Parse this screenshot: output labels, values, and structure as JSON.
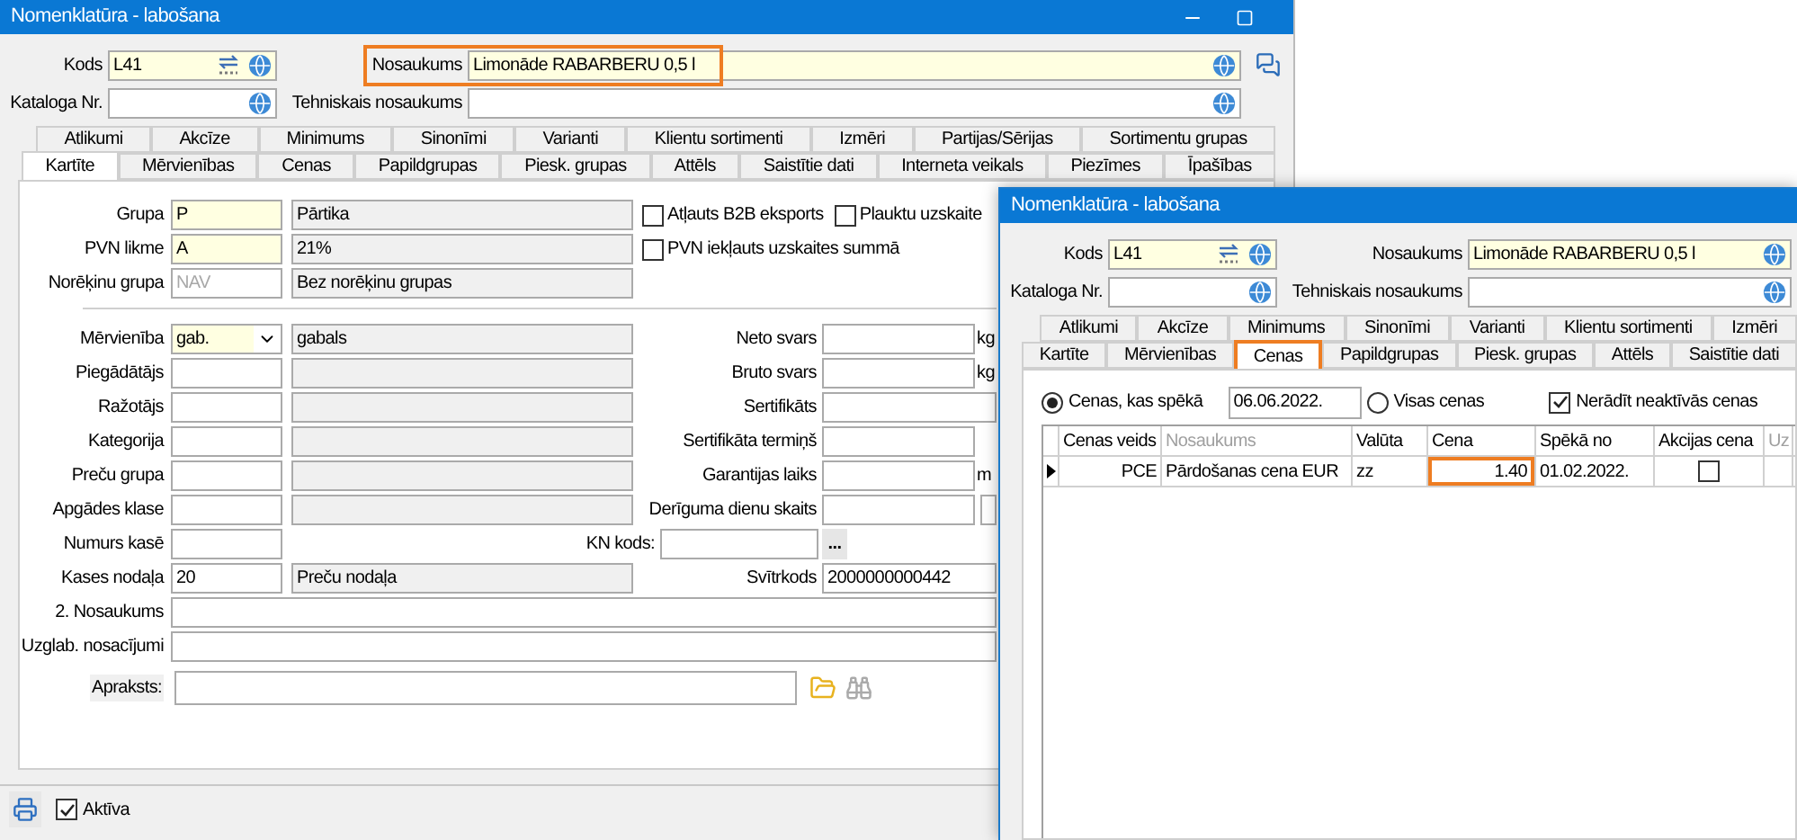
{
  "main_window": {
    "title": "Nomenklatūra - labošana",
    "header_rows": [
      {
        "code": {
          "label": "Kods",
          "value": "L41",
          "kind": "required",
          "numbering": true
        },
        "name": {
          "label": "Nosaukums",
          "value": "Limonāde RABARBERU 0,5 l",
          "kind": "required",
          "highlighted": true
        }
      },
      {
        "code": {
          "label": "Kataloga Nr.",
          "kind": "plain",
          "numbering": false
        },
        "name": {
          "label": "Tehniskais nosaukums",
          "kind": "plain",
          "highlighted": false
        }
      }
    ],
    "tab_rows": [
      [
        {
          "label": "Atlikumi",
          "selected": false
        },
        {
          "label": "Akcīze",
          "selected": false
        },
        {
          "label": "Minimums",
          "selected": false
        },
        {
          "label": "Sinonīmi",
          "selected": false
        },
        {
          "label": "Varianti",
          "selected": false
        },
        {
          "label": "Klientu sortimenti",
          "selected": false
        },
        {
          "label": "Izmēri",
          "selected": false
        },
        {
          "label": "Partijas/Sērijas",
          "selected": false
        },
        {
          "label": "Sortimentu grupas",
          "selected": false
        }
      ],
      [
        {
          "label": "Kartīte",
          "selected": true
        },
        {
          "label": "Mērvienības",
          "selected": false
        },
        {
          "label": "Cenas",
          "selected": false
        },
        {
          "label": "Papildgrupas",
          "selected": false
        },
        {
          "label": "Piesk. grupas",
          "selected": false
        },
        {
          "label": "Attēls",
          "selected": false
        },
        {
          "label": "Saistītie dati",
          "selected": false
        },
        {
          "label": "Interneta veikals",
          "selected": false
        },
        {
          "label": "Piezīmes",
          "selected": false
        },
        {
          "label": "Īpašības",
          "selected": false
        }
      ]
    ],
    "top_rows": [
      {
        "label": "Grupa",
        "code": {
          "value": "P",
          "kind": "required"
        },
        "name": "Pārtika",
        "checkboxes": [
          {
            "label": "Atļauts B2B eksports",
            "checked": false
          },
          {
            "label": "Plauktu uzskaite",
            "checked": false
          }
        ]
      },
      {
        "label": "PVN likme",
        "code": {
          "value": "A",
          "kind": "required"
        },
        "name": "21%",
        "checkboxes": [
          {
            "label": "PVN iekļauts uzskaites summā",
            "checked": false
          }
        ]
      },
      {
        "label": "Norēķinu grupa",
        "code": {
          "value": "NAV",
          "kind": "disabled"
        },
        "name": "Bez norēķinu grupas"
      }
    ],
    "detail_rows": [
      {
        "label": "Mērvienība",
        "kind": "lookup",
        "code": {
          "value": "gab.",
          "kind": "dropdown"
        },
        "name": "gabals",
        "right": {
          "label": "Neto svars",
          "kind": "unit",
          "unit": "kg"
        }
      },
      {
        "label": "Piegādātājs",
        "kind": "lookup",
        "code": {
          "kind": "plain"
        },
        "right": {
          "label": "Bruto svars",
          "kind": "unit",
          "unit": "kg"
        }
      },
      {
        "label": "Ražotājs",
        "kind": "lookup",
        "code": {
          "kind": "plain"
        },
        "right": {
          "label": "Sertifikāts",
          "kind": "wide"
        }
      },
      {
        "label": "Kategorija",
        "kind": "lookup",
        "code": {
          "kind": "plain"
        },
        "right": {
          "label": "Sertifikāta termiņš",
          "kind": "field"
        }
      },
      {
        "label": "Preču grupa",
        "kind": "lookup",
        "code": {
          "kind": "plain"
        },
        "right": {
          "label": "Garantijas laiks",
          "kind": "unit",
          "unit": "m"
        }
      },
      {
        "label": "Apgādes klase",
        "kind": "lookup",
        "code": {
          "kind": "plain"
        },
        "right": {
          "label": "Derīguma dienu skaits",
          "kind": "pair"
        }
      },
      {
        "label": "Numurs kasē",
        "kind": "single",
        "code": {
          "kind": "plain"
        },
        "right": {
          "label": "KN kods:",
          "kind": "picker",
          "button": "..."
        }
      },
      {
        "label": "Kases nodaļa",
        "kind": "lookup",
        "code": {
          "value": "20",
          "kind": "plain"
        },
        "name": "Preču nodaļa",
        "right": {
          "label": "Svītrkods",
          "kind": "wide",
          "value": "2000000000442"
        }
      }
    ],
    "full_rows": [
      {
        "label": "2. Nosaukums"
      },
      {
        "label": "Uzglab. nosacījumi"
      }
    ],
    "description": {
      "label": "Apraksts:"
    },
    "footer": {
      "active": {
        "label": "Aktīva",
        "checked": true
      }
    }
  },
  "price_window": {
    "title": "Nomenklatūra - labošana",
    "header_rows": [
      {
        "code": {
          "label": "Kods",
          "value": "L41",
          "kind": "required",
          "numbering": true
        },
        "name": {
          "label": "Nosaukums",
          "value": "Limonāde RABARBERU 0,5 l",
          "kind": "required",
          "highlighted": false
        }
      },
      {
        "code": {
          "label": "Kataloga Nr.",
          "kind": "plain",
          "numbering": false
        },
        "name": {
          "label": "Tehniskais nosaukums",
          "kind": "plain",
          "highlighted": false
        }
      }
    ],
    "tab_rows": [
      [
        {
          "label": "Atlikumi",
          "selected": false
        },
        {
          "label": "Akcīze",
          "selected": false
        },
        {
          "label": "Minimums",
          "selected": false
        },
        {
          "label": "Sinonīmi",
          "selected": false
        },
        {
          "label": "Varianti",
          "selected": false
        },
        {
          "label": "Klientu sortimenti",
          "selected": false
        },
        {
          "label": "Izmēri",
          "selected": false
        }
      ],
      [
        {
          "label": "Kartīte",
          "selected": false
        },
        {
          "label": "Mērvienības",
          "selected": false
        },
        {
          "label": "Cenas",
          "selected": true,
          "highlighted": true
        },
        {
          "label": "Papildgrupas",
          "selected": false
        },
        {
          "label": "Piesk. grupas",
          "selected": false
        },
        {
          "label": "Attēls",
          "selected": false
        },
        {
          "label": "Saistītie dati",
          "selected": false
        }
      ]
    ],
    "filters": {
      "radios": [
        {
          "label": "Cenas, kas spēkā",
          "selected": true
        },
        {
          "label": "Visas cenas",
          "selected": false
        }
      ],
      "date": "06.06.2022.",
      "checkbox": {
        "label": "Nerādīt neaktīvās cenas",
        "checked": true
      }
    },
    "grid": {
      "columns": [
        {
          "label": "Cenas veids",
          "dimmed": false
        },
        {
          "label": "Nosaukums",
          "dimmed": true
        },
        {
          "label": "Valūta",
          "dimmed": false
        },
        {
          "label": "Cena",
          "dimmed": false
        },
        {
          "label": "Spēkā no",
          "dimmed": false
        },
        {
          "label": "Akcijas cena",
          "dimmed": false
        },
        {
          "label": "Uz",
          "dimmed": true
        }
      ],
      "rows": [
        {
          "current": true,
          "cells": [
            {
              "kind": "number",
              "text": "PCE"
            },
            {
              "kind": "text",
              "text": "Pārdošanas cena EUR"
            },
            {
              "kind": "text",
              "text": "zz"
            },
            {
              "kind": "number",
              "text": "1.40",
              "highlighted": true
            },
            {
              "kind": "text",
              "text": "01.02.2022."
            },
            {
              "kind": "check",
              "checked": false
            },
            {
              "kind": "empty"
            }
          ]
        }
      ]
    }
  }
}
